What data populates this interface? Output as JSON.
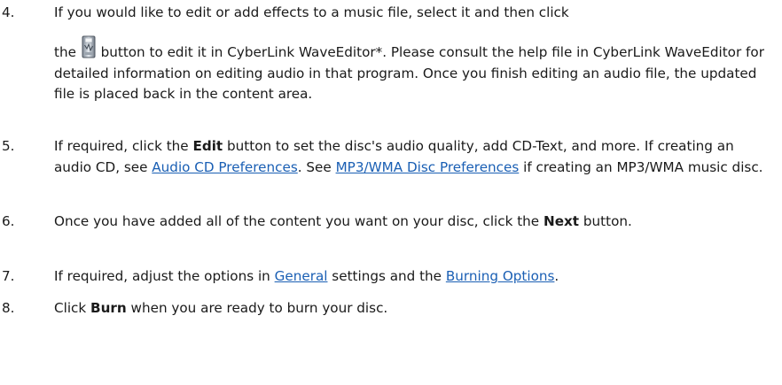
{
  "steps": [
    {
      "number": "4.",
      "line1": "If you would like to edit or add effects to a music file, select it and then click",
      "pre_icon": "the",
      "icon": "wave-editor-icon",
      "post_icon": " button to edit it in CyberLink WaveEditor*. Please consult the help file in CyberLink WaveEditor for detailed information on editing audio in that program. Once you finish editing an audio file, the updated file is placed back in the content area."
    },
    {
      "number": "5.",
      "t1": "If required, click the ",
      "bold1": "Edit",
      "t2": " button to set the disc's audio quality, add CD-Text, and more. If creating an audio CD, see ",
      "link1": "Audio CD Preferences",
      "t3": ". See ",
      "link2": "MP3/WMA Disc Preferences",
      "t4": " if creating an MP3/WMA music disc."
    },
    {
      "number": "6.",
      "t1": "Once you have added all of the content you want on your disc, click the ",
      "bold1": "Next",
      "t2": " button."
    },
    {
      "number": "7.",
      "t1": "If required, adjust the options in ",
      "link1": "General",
      "t2": " settings and the ",
      "link2": "Burning Options",
      "t3": "."
    },
    {
      "number": "8.",
      "t1": "Click ",
      "bold1": "Burn",
      "t2": " when you are ready to burn your disc."
    }
  ],
  "colors": {
    "text": "#1a1a1a",
    "link": "#1a5fb4"
  }
}
